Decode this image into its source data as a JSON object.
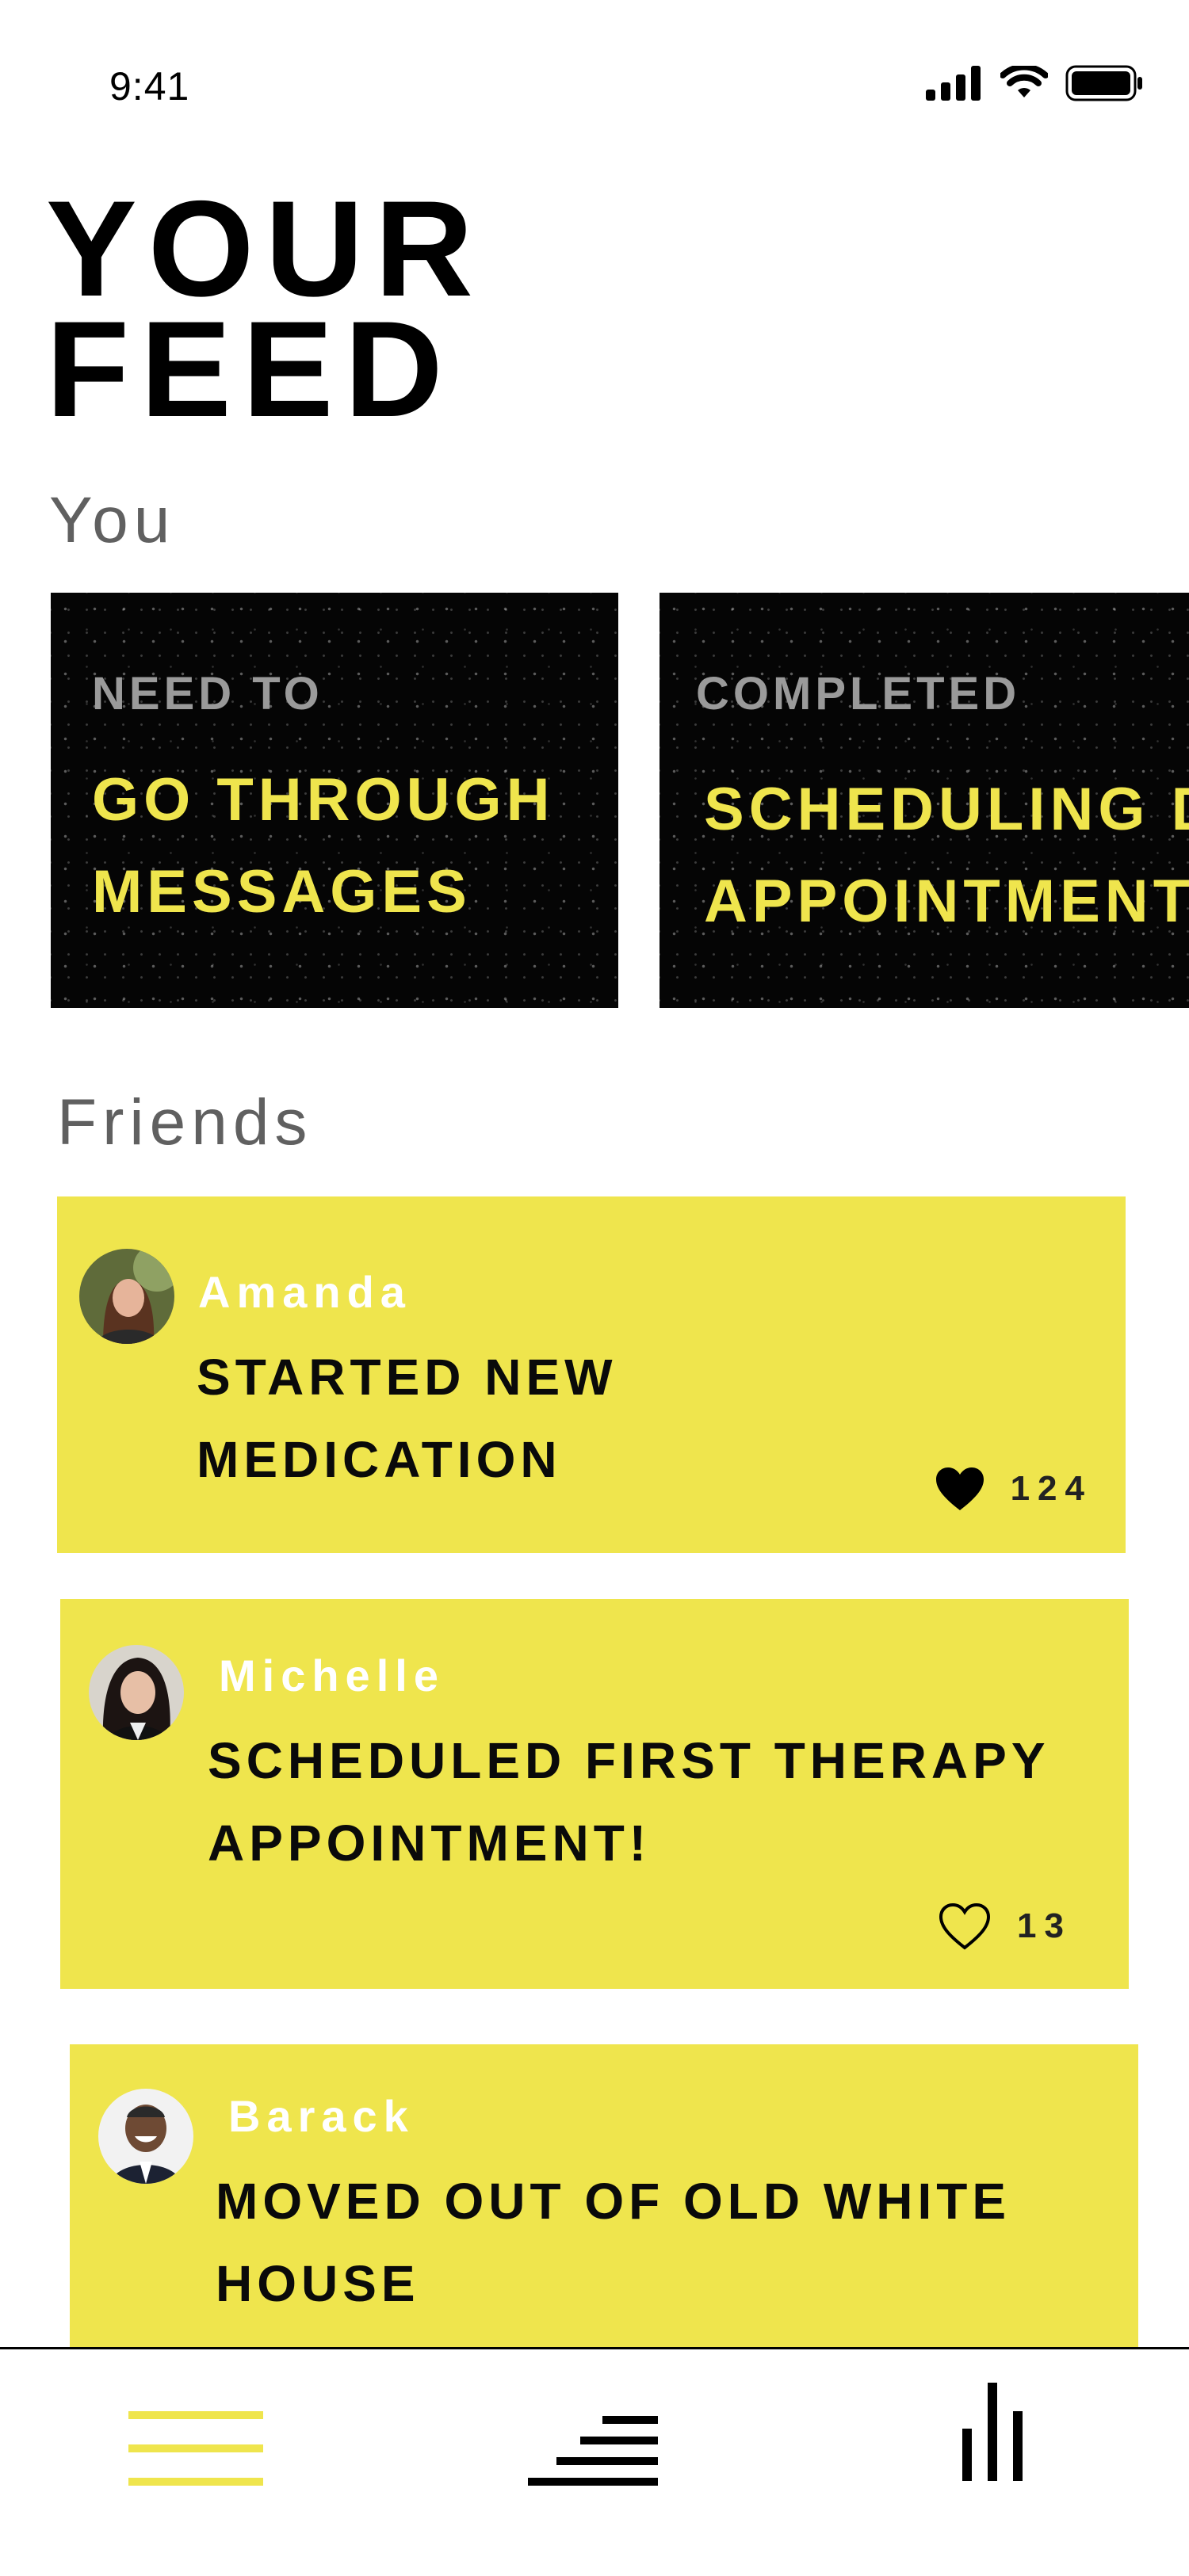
{
  "status_bar": {
    "time": "9:41",
    "icons": [
      "signal-icon",
      "wifi-icon",
      "battery-icon"
    ]
  },
  "header": {
    "title_line1": "YOUR",
    "title_line2": "FEED"
  },
  "you_section": {
    "label": "You",
    "cards": [
      {
        "status": "NEED TO",
        "task_line1": "GO THROUGH",
        "task_line2": "MESSAGES"
      },
      {
        "status": "COMPLETED",
        "task_line1": "SCHEDULING D",
        "task_line2": "APPOINTMENT"
      }
    ]
  },
  "friends_section": {
    "label": "Friends",
    "items": [
      {
        "name": "Amanda",
        "activity_line1": "STARTED NEW",
        "activity_line2": "MEDICATION",
        "likes": "124",
        "liked": true
      },
      {
        "name": "Michelle",
        "activity_line1": "SCHEDULED FIRST THERAPY",
        "activity_line2": "APPOINTMENT!",
        "likes": "13",
        "liked": false
      },
      {
        "name": "Barack",
        "activity_line1": "MOVED OUT OF OLD WHITE",
        "activity_line2": "HOUSE"
      }
    ]
  },
  "tab_bar": {
    "tabs": [
      "menu-icon",
      "steps-icon",
      "stats-icon"
    ],
    "active_color": "#efe54d"
  },
  "colors": {
    "accent": "#efe54d",
    "card_dark": "#050505",
    "section_label": "#606060"
  }
}
